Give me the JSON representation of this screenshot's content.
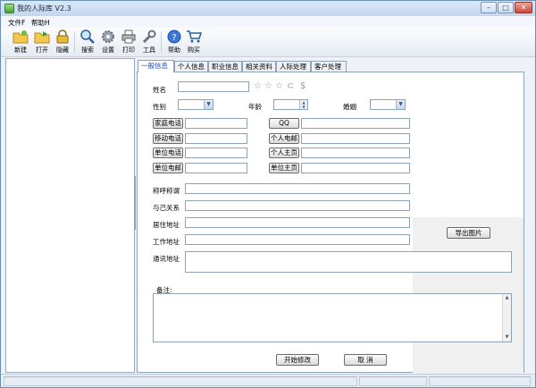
{
  "window": {
    "title": "我的人际库 V2.3"
  },
  "menu": [
    "文件F",
    "帮助H"
  ],
  "toolbar": [
    {
      "label": "新建",
      "icon": "new-folder-icon"
    },
    {
      "label": "打开",
      "icon": "open-folder-icon"
    },
    {
      "label": "隐藏",
      "icon": "lock-icon"
    },
    {
      "label": "搜索",
      "icon": "search-icon"
    },
    {
      "label": "设置",
      "icon": "gear-icon"
    },
    {
      "label": "打印",
      "icon": "printer-icon"
    },
    {
      "label": "工具",
      "icon": "wrench-icon"
    },
    {
      "label": "帮助",
      "icon": "help-icon"
    },
    {
      "label": "购买",
      "icon": "cart-icon"
    }
  ],
  "tabs": [
    "一般信息",
    "个人信息",
    "职业信息",
    "相关资料",
    "人际处理",
    "客户处理"
  ],
  "form": {
    "name_label": "姓名",
    "gender_label": "性别",
    "age_label": "年龄",
    "marriage_label": "婚姻",
    "phone_buttons_left": [
      "家庭电话",
      "移动电话",
      "单位电话",
      "单位电邮"
    ],
    "phone_buttons_right": [
      "QQ",
      "个人电邮",
      "个人主页",
      "单位主页"
    ],
    "address_labels": [
      "称呼称谓",
      "与己关系",
      "居住地址",
      "工作地址"
    ],
    "contact_address_label": "通讯地址",
    "notes_label": "备注:",
    "export_button": "导出图片",
    "save_button": "开始修改",
    "cancel_button": "取 消"
  },
  "colors": {
    "accent": "#1f4fa8",
    "star": "#9a9a9a"
  }
}
